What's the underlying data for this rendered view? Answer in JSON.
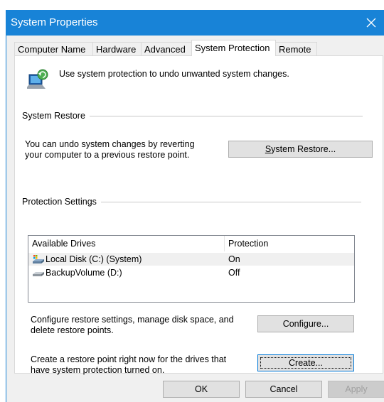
{
  "window": {
    "title": "System Properties",
    "close_label": "×"
  },
  "tabs": [
    {
      "label": "Computer Name",
      "active": false
    },
    {
      "label": "Hardware",
      "active": false
    },
    {
      "label": "Advanced",
      "active": false
    },
    {
      "label": "System Protection",
      "active": true
    },
    {
      "label": "Remote",
      "active": false
    }
  ],
  "intro": {
    "text": "Use system protection to undo unwanted system changes.",
    "icon": "system-protection-icon"
  },
  "system_restore": {
    "section_label": "System Restore",
    "description": "You can undo system changes by reverting your computer to a previous restore point.",
    "button_label": "System Restore...",
    "button_accel": "S"
  },
  "protection": {
    "section_label": "Protection Settings",
    "columns": [
      "Available Drives",
      "Protection"
    ],
    "drives": [
      {
        "name": "Local Disk (C:) (System)",
        "protection": "On",
        "icon": "system-drive-icon",
        "selected": true
      },
      {
        "name": "BackupVolume (D:)",
        "protection": "Off",
        "icon": "drive-icon",
        "selected": false
      }
    ],
    "configure_text": "Configure restore settings, manage disk space, and delete restore points.",
    "configure_label": "Configure...",
    "create_text": "Create a restore point right now for the drives that have system protection turned on.",
    "create_label": "Create..."
  },
  "footer": {
    "ok_label": "OK",
    "cancel_label": "Cancel",
    "apply_label": "Apply"
  },
  "colors": {
    "titlebar": "#1883d7",
    "dialog_bg": "#f0f0f0",
    "button_bg": "#e1e1e1",
    "focus_border": "#0078d7"
  }
}
